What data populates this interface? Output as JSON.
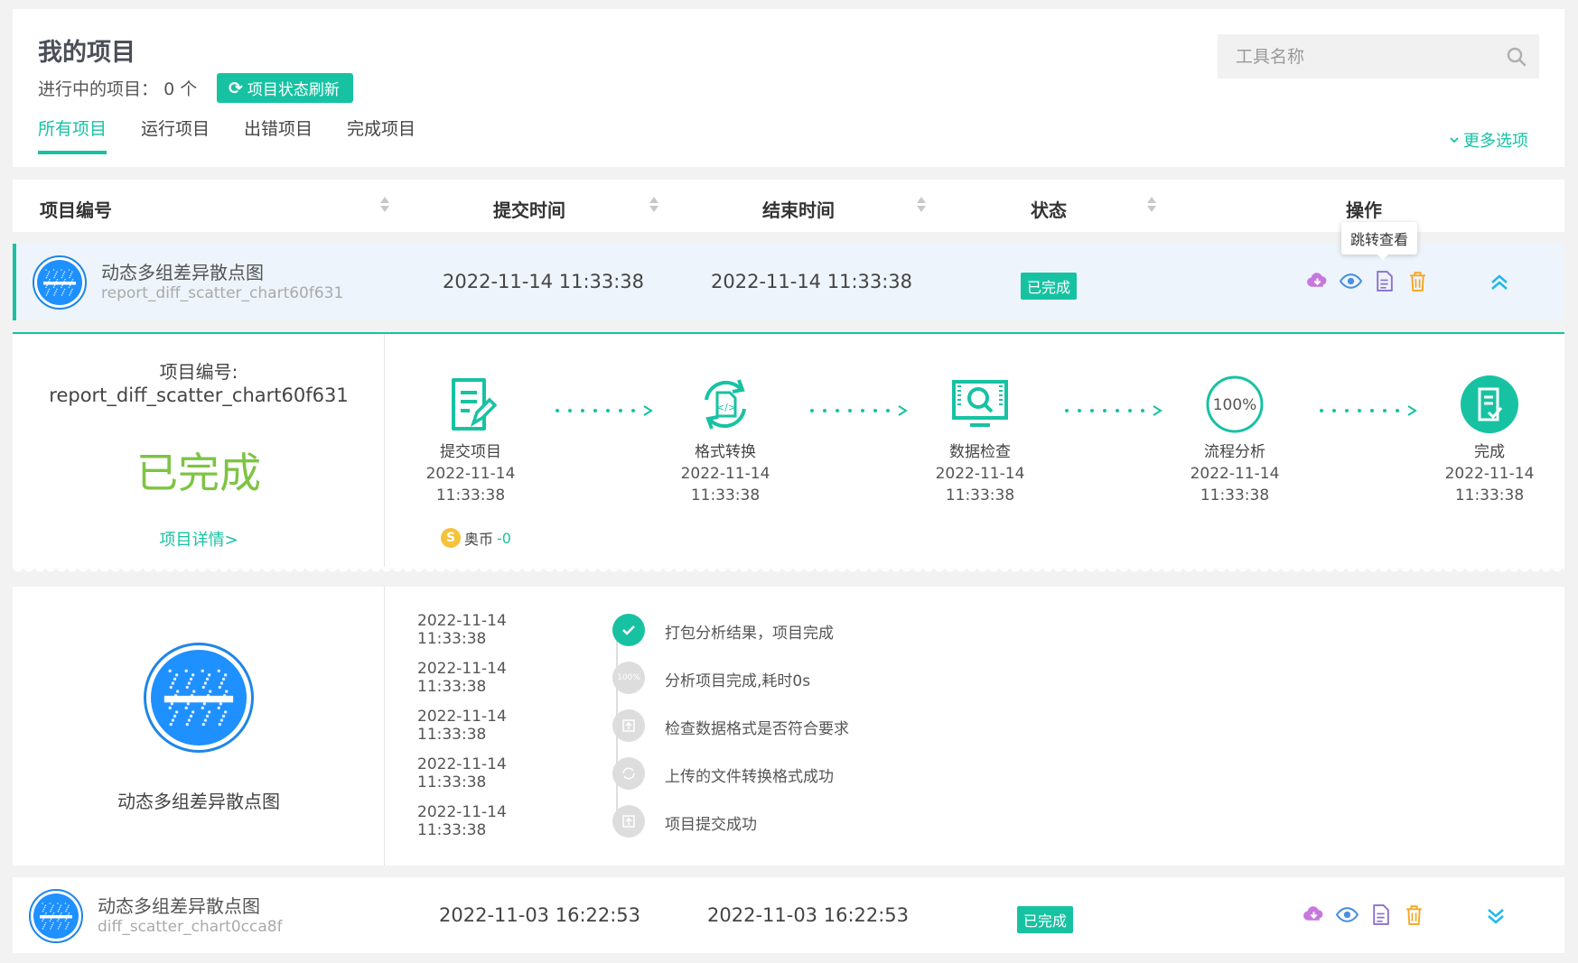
{
  "header": {
    "title": "我的项目",
    "running_label": "进行中的项目：",
    "running_count": "0 个",
    "refresh_label": "项目状态刷新",
    "search_placeholder": "工具名称",
    "more_options": "更多选项",
    "tabs": [
      {
        "label": "所有项目",
        "active": true
      },
      {
        "label": "运行项目",
        "active": false
      },
      {
        "label": "出错项目",
        "active": false
      },
      {
        "label": "完成项目",
        "active": false
      }
    ]
  },
  "table": {
    "columns": [
      "项目编号",
      "提交时间",
      "结束时间",
      "状态",
      "操作"
    ]
  },
  "rows": [
    {
      "name": "动态多组差异散点图",
      "id": "report_diff_scatter_chart60f631",
      "submit_time": "2022-11-14 11:33:38",
      "end_time": "2022-11-14 11:33:38",
      "status": "已完成",
      "expanded": true
    },
    {
      "name": "动态多组差异散点图",
      "id": "diff_scatter_chart0cca8f",
      "submit_time": "2022-11-03 16:22:53",
      "end_time": "2022-11-03 16:22:53",
      "status": "已完成",
      "expanded": false
    }
  ],
  "tooltip": "跳转查看",
  "detail": {
    "label": "项目编号:",
    "id": "report_diff_scatter_chart60f631",
    "status": "已完成",
    "link": "项目详情>",
    "coin_label": "奥币",
    "coin_value": "-0",
    "steps": [
      {
        "name": "提交项目",
        "date": "2022-11-14",
        "time": "11:33:38",
        "icon": "edit-doc-icon"
      },
      {
        "name": "格式转换",
        "date": "2022-11-14",
        "time": "11:33:38",
        "icon": "convert-icon"
      },
      {
        "name": "数据检查",
        "date": "2022-11-14",
        "time": "11:33:38",
        "icon": "monitor-search-icon"
      },
      {
        "name": "流程分析",
        "date": "2022-11-14",
        "time": "11:33:38",
        "icon": "percent-icon",
        "badge": "100%"
      },
      {
        "name": "完成",
        "date": "2022-11-14",
        "time": "11:33:38",
        "icon": "done-doc-icon"
      }
    ]
  },
  "timeline": {
    "name": "动态多组差异散点图",
    "items": [
      {
        "time": "2022-11-14 11:33:38",
        "text": "打包分析结果，项目完成",
        "icon": "check-icon",
        "done": true
      },
      {
        "time": "2022-11-14 11:33:38",
        "text": "分析项目完成,耗时0s",
        "icon": "percent-icon",
        "badge": "100%",
        "done": false
      },
      {
        "time": "2022-11-14 11:33:38",
        "text": "检查数据格式是否符合要求",
        "icon": "upload-icon",
        "done": false
      },
      {
        "time": "2022-11-14 11:33:38",
        "text": "上传的文件转换格式成功",
        "icon": "refresh-icon",
        "done": false
      },
      {
        "time": "2022-11-14 11:33:38",
        "text": "项目提交成功",
        "icon": "upload-icon",
        "done": false
      }
    ]
  },
  "colors": {
    "accent": "#17c2a3",
    "done_green": "#7dc443",
    "avatar_blue": "#1e90ff",
    "op_cloud": "#c678dd",
    "op_eye": "#4a90e2",
    "op_doc": "#8a6fd1",
    "op_trash": "#f5a623"
  }
}
